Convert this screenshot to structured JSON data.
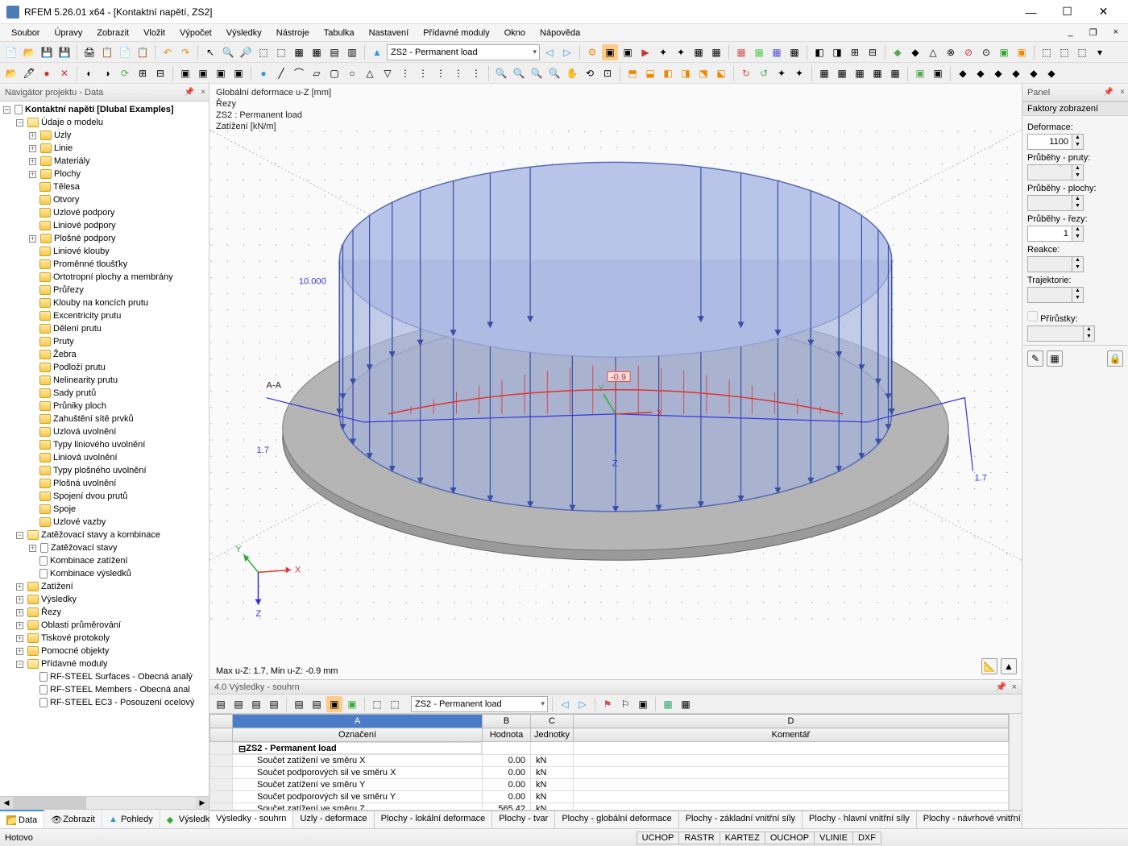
{
  "title": "RFEM 5.26.01 x64 - [Kontaktní napětí, ZS2]",
  "menu": [
    "Soubor",
    "Úpravy",
    "Zobrazit",
    "Vložit",
    "Výpočet",
    "Výsledky",
    "Nástroje",
    "Tabulka",
    "Nastavení",
    "Přídavné moduly",
    "Okno",
    "Nápověda"
  ],
  "combo_main": "ZS2 - Permanent load",
  "navigator": {
    "title": "Navigátor projektu - Data",
    "root": "Kontaktní napětí [Dlubal Examples]",
    "model_data": "Údaje o modelu",
    "items": [
      "Uzly",
      "Linie",
      "Materiály",
      "Plochy",
      "Tělesa",
      "Otvory",
      "Uzlové podpory",
      "Liniové podpory",
      "Plošné podpory",
      "Liniové klouby",
      "Proměnné tloušťky",
      "Ortotropní plochy a membrány",
      "Průřezy",
      "Klouby na koncích prutu",
      "Excentricity prutu",
      "Dělení prutu",
      "Pruty",
      "Žebra",
      "Podloží prutu",
      "Nelinearity prutu",
      "Sady prutů",
      "Průniky ploch",
      "Zahuštění sítě prvků",
      "Uzlová uvolnění",
      "Typy liniového uvolnění",
      "Liniová uvolnění",
      "Typy plošného uvolnění",
      "Plošná uvolnění",
      "Spojení dvou prutů",
      "Spoje",
      "Uzlové vazby"
    ],
    "load_cases_group": "Zatěžovací stavy a kombinace",
    "load_cases_items": [
      "Zatěžovací stavy",
      "Kombinace zatížení",
      "Kombinace výsledků"
    ],
    "extras": [
      "Zatížení",
      "Výsledky",
      "Řezy",
      "Oblasti průměrování",
      "Tiskové protokoly",
      "Pomocné objekty",
      "Přídavné moduly"
    ],
    "modules": [
      "RF-STEEL Surfaces - Obecná analý",
      "RF-STEEL Members - Obecná anal",
      "RF-STEEL EC3 - Posouzení ocelový"
    ],
    "tabs": [
      "Data",
      "Zobrazit",
      "Pohledy",
      "Výsledky"
    ]
  },
  "viewport": {
    "line1": "Globální deformace u-Z [mm]",
    "line2": "Řezy",
    "line3": "ZS2 : Permanent load",
    "line4": "Zatížení [kN/m]",
    "label_left": "10.000",
    "label_bl": "1.7",
    "label_br": "1.7",
    "label_mid": "-0.9",
    "label_aa": "A-A",
    "bottom": "Max u-Z: 1.7, Min u-Z: -0.9 mm"
  },
  "results": {
    "title": "4.0 Výsledky - souhrn",
    "combo": "ZS2 - Permanent load",
    "columns_letters": [
      "A",
      "B",
      "C",
      "D"
    ],
    "columns": [
      "Označení",
      "Hodnota",
      "Jednotky",
      "Komentář"
    ],
    "group": "ZS2 - Permanent load",
    "rows": [
      {
        "name": "Součet zatížení ve směru X",
        "val": "0.00",
        "unit": "kN"
      },
      {
        "name": "Součet podporových sil ve směru X",
        "val": "0.00",
        "unit": "kN"
      },
      {
        "name": "Součet zatížení ve směru Y",
        "val": "0.00",
        "unit": "kN"
      },
      {
        "name": "Součet podporových sil ve směru Y",
        "val": "0.00",
        "unit": "kN"
      },
      {
        "name": "Součet zatížení ve směru Z",
        "val": "565.42",
        "unit": "kN"
      }
    ]
  },
  "bottom_tabs": [
    "Výsledky - souhrn",
    "Uzly - deformace",
    "Plochy - lokální deformace",
    "Plochy - tvar",
    "Plochy - globální deformace",
    "Plochy - základní vnitřní síly",
    "Plochy - hlavní vnitřní síly",
    "Plochy - návrhové vnitřní síly"
  ],
  "right_panel": {
    "title": "Panel",
    "factors_title": "Faktory zobrazení",
    "labels": {
      "deform": "Deformace:",
      "pruty": "Průběhy - pruty:",
      "plochy": "Průběhy - plochy:",
      "rezy": "Průběhy - řezy:",
      "reakce": "Reakce:",
      "traj": "Trajektorie:",
      "prirustky": "Přírůstky:"
    },
    "values": {
      "deform": "1100",
      "rezy": "1"
    }
  },
  "status": {
    "ready": "Hotovo",
    "cells": [
      "UCHOP",
      "RASTR",
      "KARTEZ",
      "OUCHOP",
      "VLINIE",
      "DXF"
    ]
  }
}
